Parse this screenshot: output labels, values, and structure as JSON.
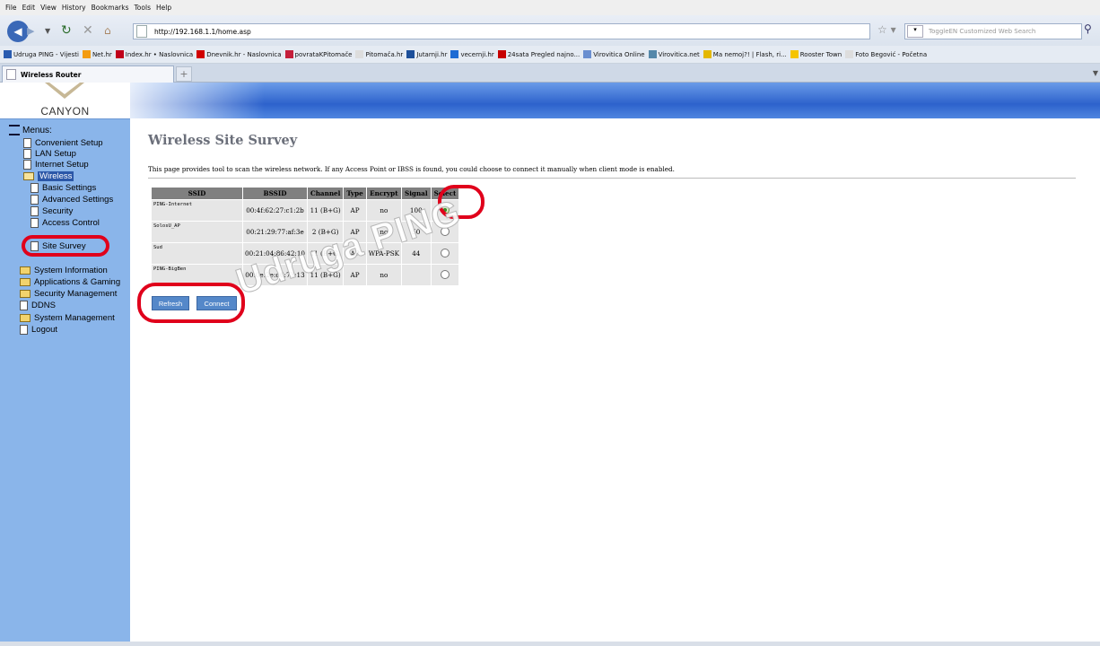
{
  "browser": {
    "menu": [
      "File",
      "Edit",
      "View",
      "History",
      "Bookmarks",
      "Tools",
      "Help"
    ],
    "url": "http://192.168.1.1/home.asp",
    "search_placeholder": "ToggleEN Customized Web Search",
    "bookmarks": [
      {
        "label": "Udruga PING - Vijesti",
        "color": "#2a5cb0"
      },
      {
        "label": "Net.hr",
        "color": "#f39c12"
      },
      {
        "label": "Index.hr • Naslovnica",
        "color": "#c0001a"
      },
      {
        "label": "Dnevnik.hr - Naslovnica",
        "color": "#d10000"
      },
      {
        "label": "povrataKPitomače",
        "color": "#c41f3b"
      },
      {
        "label": "Pitomača.hr",
        "color": "#dddddd"
      },
      {
        "label": "Jutarnji.hr",
        "color": "#1d4f9a"
      },
      {
        "label": "vecernji.hr",
        "color": "#1d6bd4"
      },
      {
        "label": "24sata Pregled najno...",
        "color": "#c70000"
      },
      {
        "label": "Virovitica Online",
        "color": "#6a8fd0"
      },
      {
        "label": "Virovitica.net",
        "color": "#58a"
      },
      {
        "label": "Ma nemoj?! | Flash, ri...",
        "color": "#e4b800"
      },
      {
        "label": "Rooster Town",
        "color": "#f5c400"
      },
      {
        "label": "Foto Begović - Početna",
        "color": "#dddddd"
      }
    ],
    "tab_title": "Wireless Router",
    "new_tab": "+"
  },
  "logo": {
    "brand": "CANYON"
  },
  "sidebar": {
    "title": "Menus:",
    "items": [
      {
        "label": "Convenient Setup",
        "icon": "doc"
      },
      {
        "label": "LAN Setup",
        "icon": "doc"
      },
      {
        "label": "Internet Setup",
        "icon": "doc"
      },
      {
        "label": "Wireless",
        "icon": "folder-open"
      },
      {
        "label": "Basic Settings",
        "icon": "doc"
      },
      {
        "label": "Advanced Settings",
        "icon": "doc"
      },
      {
        "label": "Security",
        "icon": "doc"
      },
      {
        "label": "Access Control",
        "icon": "doc"
      },
      {
        "label": "Site Survey",
        "icon": "doc"
      },
      {
        "label": "System Information",
        "icon": "folder"
      },
      {
        "label": "Applications & Gaming",
        "icon": "folder"
      },
      {
        "label": "Security Management",
        "icon": "folder"
      },
      {
        "label": "DDNS",
        "icon": "doc"
      },
      {
        "label": "System Management",
        "icon": "folder"
      },
      {
        "label": "Logout",
        "icon": "doc"
      }
    ]
  },
  "main": {
    "title": "Wireless Site Survey",
    "description": "This page provides tool to scan the wireless network. If any Access Point or IBSS is found, you could choose to connect it manually when client mode is enabled.",
    "table": {
      "headers": [
        "SSID",
        "BSSID",
        "Channel",
        "Type",
        "Encrypt",
        "Signal",
        "Select"
      ],
      "rows": [
        {
          "ssid": "PING-Internet",
          "bssid": "00:4f:62:27:c1:2b",
          "channel": "11 (B+G)",
          "type": "AP",
          "encrypt": "no",
          "signal": "100",
          "selected": true
        },
        {
          "ssid": "SolosU_AP",
          "bssid": "00:21:29:77:af:3e",
          "channel": "2 (B+G)",
          "type": "AP",
          "encrypt": "no",
          "signal": "50",
          "selected": false
        },
        {
          "ssid": "Sud",
          "bssid": "00:21:04:86:42:10",
          "channel": "11 (B+G)",
          "type": "AP",
          "encrypt": "WPA-PSK",
          "signal": "44",
          "selected": false
        },
        {
          "ssid": "PING-BigBen",
          "bssid": "00:0e:2e:d6:73:13",
          "channel": "11 (B+G)",
          "type": "AP",
          "encrypt": "no",
          "signal": "",
          "selected": false
        }
      ]
    },
    "buttons": {
      "refresh": "Refresh",
      "connect": "Connect"
    }
  },
  "watermark": "Udruga PING",
  "colors": {
    "sidebar_bg": "#8ab5ea",
    "banner": "#2d62cc",
    "annotation_red": "#e0001b",
    "button_bg": "#5588c9"
  }
}
